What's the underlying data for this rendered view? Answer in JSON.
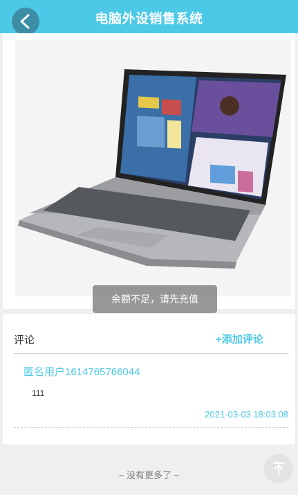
{
  "header": {
    "title": "电脑外设销售系统"
  },
  "toast": {
    "message": "余额不足，请先充值"
  },
  "comments": {
    "title": "评论",
    "add_label": "+添加评论",
    "items": [
      {
        "user": "匿名用户1614765766044",
        "text": "111",
        "time": "2021-03-03 18:03:08"
      }
    ]
  },
  "footer": {
    "no_more": "~ 没有更多了 ~"
  },
  "icons": {
    "back": "chevron-left-icon",
    "back_to_top": "arrow-up-icon"
  },
  "colors": {
    "accent": "#4cc9e6",
    "back_button": "#3e8aa3",
    "background": "#efefef"
  }
}
